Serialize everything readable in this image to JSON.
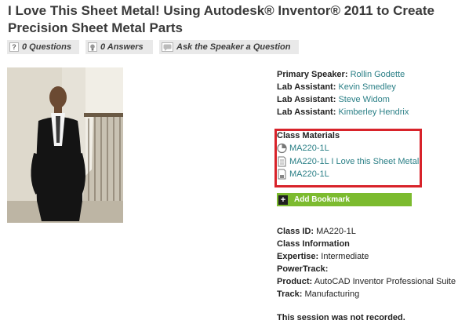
{
  "page": {
    "title_line1": "I Love This Sheet Metal! Using Autodesk® Inventor® 2011 to Create",
    "title_line2": "Precision Sheet Metal Parts"
  },
  "actions": {
    "questions": "0 Questions",
    "answers": "0 Answers",
    "ask": "Ask the Speaker a Question"
  },
  "people": [
    {
      "role": "Primary Speaker:",
      "name": "Rollin Godette"
    },
    {
      "role": "Lab Assistant:",
      "name": "Kevin Smedley"
    },
    {
      "role": "Lab Assistant:",
      "name": "Steve Widom"
    },
    {
      "role": "Lab Assistant:",
      "name": "Kimberley Hendrix"
    }
  ],
  "materials": {
    "title": "Class Materials",
    "items": [
      {
        "label": "MA220-1L",
        "icon": "pie-chart-icon"
      },
      {
        "label": "MA220-1L I Love this Sheet Metal",
        "icon": "document-icon"
      },
      {
        "label": "MA220-1L",
        "icon": "file-icon"
      }
    ]
  },
  "bookmark": {
    "label": "Add Bookmark"
  },
  "class_info": {
    "class_id_label": "Class ID:",
    "class_id": "MA220-1L",
    "heading": "Class Information",
    "expertise_label": "Expertise:",
    "expertise": "Intermediate",
    "powertrack_label": "PowerTrack:",
    "product_label": "Product:",
    "product": "AutoCAD Inventor Professional Suite",
    "track_label": "Track:",
    "track": "Manufacturing"
  },
  "recording_note": "This session was not recorded.",
  "colors": {
    "link": "#2a7f86",
    "highlight_border": "#d8232a",
    "bookmark_bg": "#7cbb2f"
  }
}
